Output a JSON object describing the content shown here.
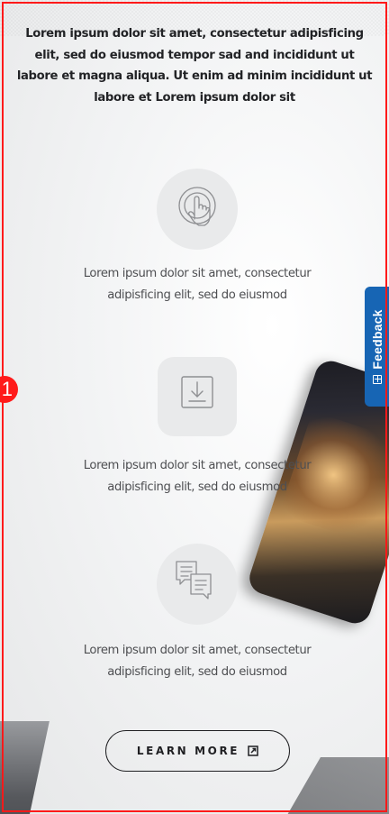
{
  "intro": {
    "text": "Lorem ipsum dolor sit amet, consectetur adipisficing elit, sed do eiusmod tempor sad and incididunt ut labore et magna aliqua. Ut enim ad minim incididunt ut labore et Lorem ipsum dolor sit"
  },
  "features": [
    {
      "icon": "touch-icon",
      "line1": "Lorem ipsum dolor sit amet, consectetur",
      "line2": "adipisficing elit, sed do eiusmod"
    },
    {
      "icon": "download-icon",
      "line1": "Lorem ipsum dolor sit amet, consectetur",
      "line2": "adipisficing elit, sed do eiusmod"
    },
    {
      "icon": "chat-icon",
      "line1": "Lorem ipsum dolor sit amet, consectetur",
      "line2": "adipisficing elit, sed do eiusmod"
    }
  ],
  "cta": {
    "label": "LEARN MORE",
    "icon": "external-link-icon"
  },
  "feedback": {
    "label": "Feedback",
    "icon": "plus-box-icon",
    "color": "#1765b4"
  },
  "selection": {
    "badge": "1",
    "color": "#ff1a1a"
  }
}
